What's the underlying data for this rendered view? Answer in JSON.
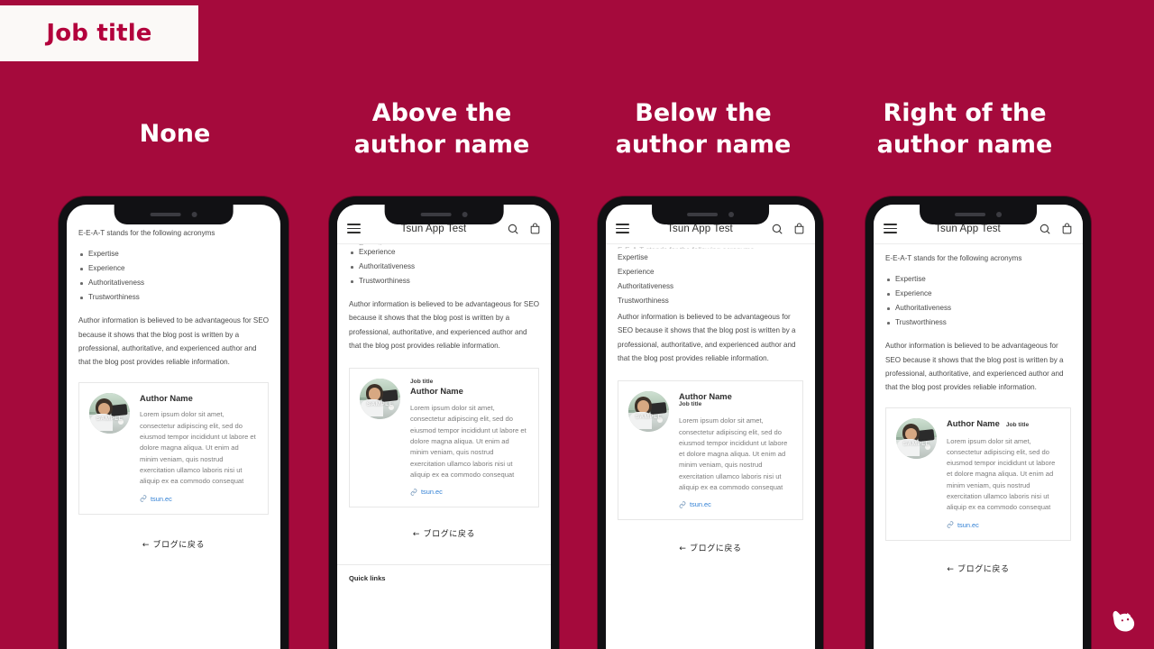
{
  "background_color": "#a50a3c",
  "title_chip": {
    "label": "Job title",
    "text_color": "#b3003c",
    "bg_color": "#fbf9f7"
  },
  "columns": [
    {
      "heading": "None",
      "job_title_position": "none"
    },
    {
      "heading": "Above the\nauthor name",
      "job_title_position": "above"
    },
    {
      "heading": "Below the\nauthor name",
      "job_title_position": "below"
    },
    {
      "heading": "Right of the\nauthor name",
      "job_title_position": "right"
    }
  ],
  "app": {
    "brand": "Tsun App Test",
    "menu_icon": "hamburger-icon",
    "search_icon": "search-icon",
    "cart_icon": "shopping-bag-icon"
  },
  "article": {
    "lead": "E-E-A-T stands for the following acronyms",
    "acronyms": [
      "Expertise",
      "Experience",
      "Authoritativeness",
      "Trustworthiness"
    ],
    "paragraph": "Author information is believed to be advantageous for SEO because it shows that the blog post is written by a professional, authoritative, and experienced author and that the blog post provides reliable information.",
    "back_link": "←  ブログに戻る",
    "quick_links": "Quick links"
  },
  "author_card": {
    "name": "Author Name",
    "job_title": "Job title",
    "bio": "Lorem ipsum dolor sit amet, consectetur adipiscing elit, sed do eiusmod tempor incididunt ut labore et dolore magna aliqua. Ut enim ad minim veniam, quis nostrud exercitation ullamco laboris nisi ut aliquip ex ea commodo consequat",
    "link_text": "tsun.ec",
    "link_color": "#2f7fd4",
    "link_icon": "link-chain-icon",
    "avatar_watermark": "SAMPLE",
    "avatar_alt": "author-photo"
  },
  "mascot": {
    "icon": "dog-head-icon",
    "color": "#ffffff"
  }
}
